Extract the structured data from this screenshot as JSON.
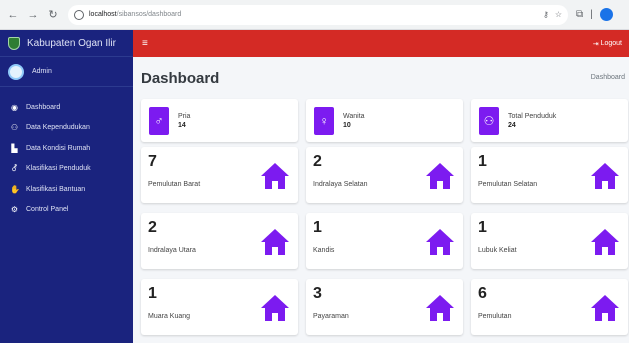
{
  "browser": {
    "url_host": "localhost",
    "url_path": "/sibansos/dashboard"
  },
  "sidebar": {
    "brand": "Kabupaten Ogan Ilir",
    "user": "Admin",
    "items": [
      {
        "label": "Dashboard",
        "icon": "palette-icon"
      },
      {
        "label": "Data Kependudukan",
        "icon": "users-icon"
      },
      {
        "label": "Data Kondisi Rumah",
        "icon": "building-icon"
      },
      {
        "label": "Klasifikasi Penduduk",
        "icon": "male-female-icon"
      },
      {
        "label": "Klasifikasi Bantuan",
        "icon": "hand-icon"
      },
      {
        "label": "Control Panel",
        "icon": "gear-icon"
      }
    ]
  },
  "topbar": {
    "logout_label": "Logout"
  },
  "page": {
    "title": "Dashboard",
    "breadcrumb": "Dashboard"
  },
  "info_boxes": [
    {
      "label": "Pria",
      "value": "14",
      "icon": "male-icon"
    },
    {
      "label": "Wanita",
      "value": "10",
      "icon": "female-icon"
    },
    {
      "label": "Total Penduduk",
      "value": "24",
      "icon": "users-icon"
    }
  ],
  "regions": [
    {
      "count": "7",
      "name": "Pemulutan Barat"
    },
    {
      "count": "2",
      "name": "Indralaya Selatan"
    },
    {
      "count": "1",
      "name": "Pemulutan Selatan"
    },
    {
      "count": "2",
      "name": "Indralaya Utara"
    },
    {
      "count": "1",
      "name": "Kandis"
    },
    {
      "count": "1",
      "name": "Lubuk Keliat"
    },
    {
      "count": "1",
      "name": "Muara Kuang"
    },
    {
      "count": "3",
      "name": "Payaraman"
    },
    {
      "count": "6",
      "name": "Pemulutan"
    }
  ],
  "colors": {
    "sidebar": "#1a237e",
    "topbar": "#d42a25",
    "accent": "#7c1bf0"
  }
}
